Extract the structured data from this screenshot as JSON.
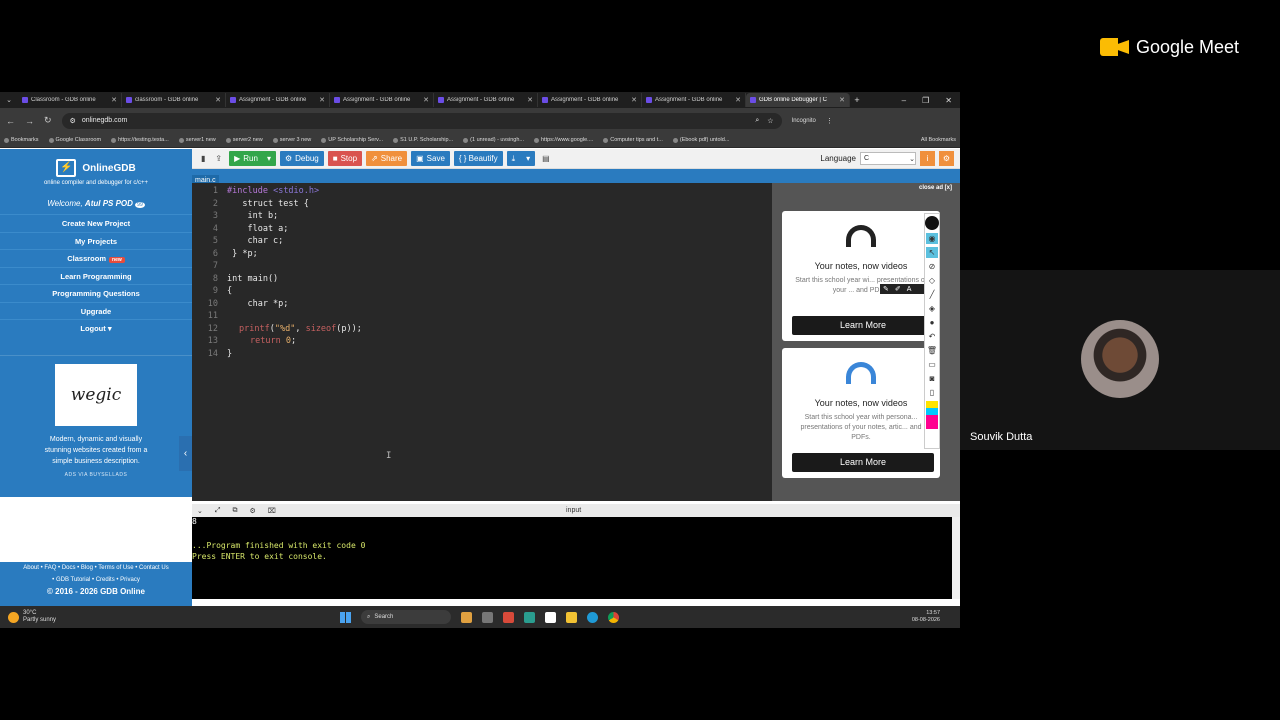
{
  "browser": {
    "tabs": [
      {
        "title": "Classroom - GDB online"
      },
      {
        "title": "classroom - GDB online"
      },
      {
        "title": "Assignment - GDB online"
      },
      {
        "title": "Assignment - GDB online"
      },
      {
        "title": "Assignment - GDB online"
      },
      {
        "title": "Assignment - GDB online"
      },
      {
        "title": "Assignment - GDB online"
      },
      {
        "title": "GDB online Debugger | C"
      }
    ],
    "url": "onlinegdb.com",
    "incognito_label": "Incognito",
    "bookmarks": [
      "Bookmarks",
      "Google Classroom",
      "https://testing.testa...",
      "server1 new",
      "server2 new",
      "server 3 new",
      "UP Scholarship Serv...",
      "S1 U.P. Scholarship...",
      "(1 unread) - uvsingh...",
      "https://www.google....",
      "Computer tips and t...",
      "(Ebook pdf) untold..."
    ],
    "all_bookmarks": "All Bookmarks"
  },
  "gdb": {
    "brand": "OnlineGDB",
    "tagline": "online compiler and debugger for c/c++",
    "welcome_prefix": "Welcome,",
    "username": "Atul PS POD",
    "badge": "99",
    "menu": [
      "Create New Project",
      "My Projects",
      "Classroom",
      "Learn Programming",
      "Programming Questions",
      "Upgrade",
      "Logout"
    ],
    "classroom_new": "new",
    "ad": {
      "logo": "wegic",
      "text": "Modern, dynamic and visually stunning websites created from a simple business description.",
      "via": "ADS VIA BUYSELLADS"
    },
    "footer_line1": "About • FAQ • Docs • Blog • Terms of Use • Contact Us",
    "footer_line2": "• GDB Tutorial • Credits • Privacy",
    "copyright": "© 2016 - 2026 GDB Online",
    "toolbar": {
      "run": "Run",
      "debug": "Debug",
      "stop": "Stop",
      "share": "Share",
      "save": "Save",
      "beautify": "{ } Beautify",
      "language_label": "Language",
      "language": "C"
    },
    "file_tab": "main.c",
    "code_line_numbers": [
      "1",
      "2",
      "3",
      "4",
      "5",
      "6",
      "7",
      "8",
      "9",
      "10",
      "11",
      "12",
      "13",
      "14"
    ],
    "code": {
      "l1_inc": "#include",
      "l1_hdr": "<stdio.h>",
      "l2": "   struct test {",
      "l3": "    int b;",
      "l4": "    float a;",
      "l5": "    char c;",
      "l6": " } *p;",
      "l8": "int main()",
      "l9": "{",
      "l10": "    char *p;",
      "l12_fn": "printf",
      "l12_open": "(",
      "l12_str": "\"%d\"",
      "l12_mid": ", ",
      "l12_fn2": "sizeof",
      "l12_end": "(p));",
      "l13_kw": "return",
      "l13_num": "0",
      "l13_end": ";",
      "l14": "}"
    },
    "console": {
      "label": "input",
      "output": "8",
      "finished": "...Program finished with exit code 0",
      "press": "Press ENTER to exit console."
    }
  },
  "right_ad": {
    "close": "close ad [x]",
    "cards": [
      {
        "heading": "Your notes, now videos",
        "body": "Start this school year wi... presentations of your ... and PDFs.",
        "button": "Learn More"
      },
      {
        "heading": "Your notes, now videos",
        "body": "Start this school year with persona... presentations of your notes, artic... and PDFs.",
        "button": "Learn More"
      }
    ]
  },
  "taskbar": {
    "temp": "30°C",
    "weather": "Partly sunny",
    "search": "Search",
    "time": "13:57",
    "date": "08-08-2026"
  },
  "meet": {
    "app_name": "Google Meet",
    "participant": "Souvik Dutta"
  },
  "colors": {
    "gdb_blue": "#2a7bbf",
    "run_green": "#33a64a",
    "stop_red": "#d9534f",
    "share_orange": "#f0903c",
    "editor_bg": "#282828"
  }
}
